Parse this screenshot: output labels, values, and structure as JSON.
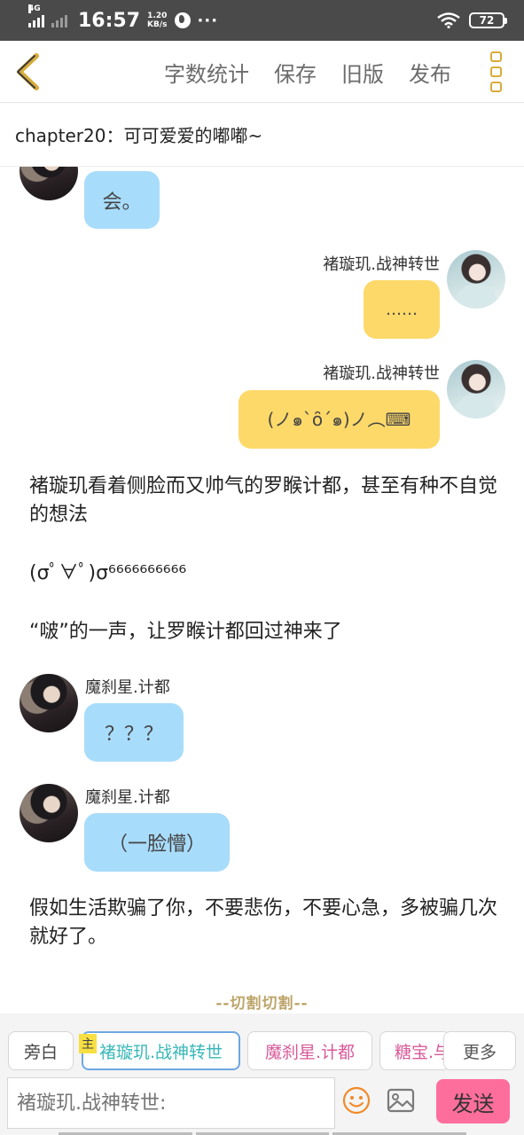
{
  "status_bar": {
    "network": "4G",
    "time": "16:57",
    "speed_value": "1.20",
    "speed_unit": "KB/s",
    "more": "···",
    "battery": "72"
  },
  "toolbar": {
    "word_count": "字数统计",
    "save": "保存",
    "old_version": "旧版",
    "publish": "发布"
  },
  "chapter_title": "chapter20：可可爱爱的嘟嘟~",
  "messages": {
    "m1": {
      "text": "会。"
    },
    "m2": {
      "speaker": "褚璇玑.战神转世",
      "text": "……"
    },
    "m3": {
      "speaker": "褚璇玑.战神转世",
      "text": "(ノ๑`ȏ´๑)ノ︵⌨"
    },
    "n1": "褚璇玑看着侧脸而又帅气的罗睺计都，甚至有种不自觉的想法",
    "n2": "(σﾟ∀ﾟ)σ⁶⁶⁶⁶⁶⁶⁶⁶⁶⁶",
    "n3": "“啵”的一声，让罗睺计都回过神来了",
    "m4": {
      "speaker": "魔刹星.计都",
      "text": "？？？"
    },
    "m5": {
      "speaker": "魔刹星.计都",
      "text": "（一脸懵）"
    },
    "n4": "假如生活欺骗了你，不要悲伤，不要心急，多被骗几次就好了。",
    "cut": "--切割切割--"
  },
  "roles": {
    "narrator": "旁白",
    "main_tag": "主",
    "role1": "褚璇玑.战神转世",
    "role2": "魔刹星.计都",
    "role3": "糖宝.与",
    "more": "更多"
  },
  "composer": {
    "placeholder": "褚璇玑.战神转世:",
    "send": "发送"
  },
  "colors": {
    "blue_bubble": "#a8dcfb",
    "yellow_bubble": "#fdd96a",
    "send_button": "#fe6e9c",
    "role1_text": "#39b7b7",
    "role2_text": "#d85a9a"
  }
}
